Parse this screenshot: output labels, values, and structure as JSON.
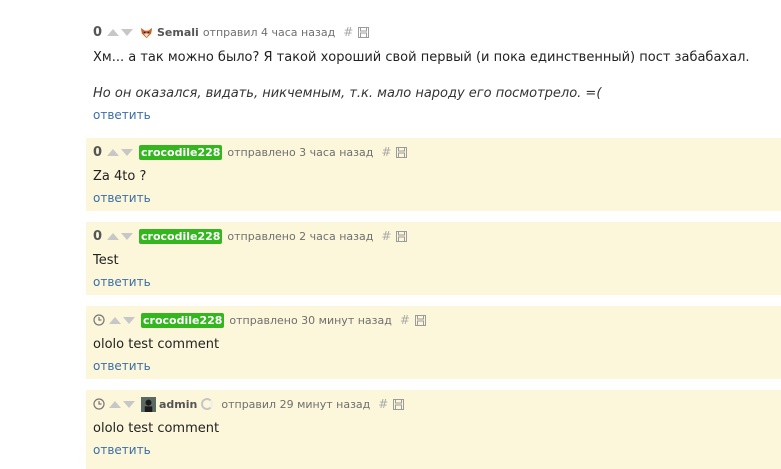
{
  "comments": [
    {
      "score": "0",
      "user": "Semali",
      "avatar_icon": "fox-avatar-icon",
      "sent": "отправил 4 часа назад",
      "hash": "#",
      "paragraphs": [
        "Хм... а так можно было? Я такой хороший свой первый (и пока единственный) пост забабахал.",
        "Но он оказался, видать, никчемным, т.к. мало народу его посмотрело. =("
      ],
      "reply": "ответить"
    },
    {
      "score": "0",
      "user": "crocodile228",
      "sent": "отправлено 3 часа назад",
      "hash": "#",
      "text": "Za 4to ?",
      "reply": "ответить"
    },
    {
      "score": "0",
      "user": "crocodile228",
      "sent": "отправлено 2 часа назад",
      "hash": "#",
      "text": "Test",
      "reply": "ответить"
    },
    {
      "user": "crocodile228",
      "sent": "отправлено 30 минут назад",
      "hash": "#",
      "text": "ololo test comment",
      "reply": "ответить",
      "score_icon": "clock-icon"
    },
    {
      "user": "admin",
      "avatar_icon": "admin-avatar-icon",
      "sent": "отправил 29 минут назад",
      "hash": "#",
      "text": "ololo test comment",
      "reply": "ответить",
      "score_icon": "clock-icon"
    }
  ],
  "colors": {
    "highlight_bg": "#fcf7da",
    "badge_green": "#34b61f",
    "link": "#3b6ea8"
  }
}
